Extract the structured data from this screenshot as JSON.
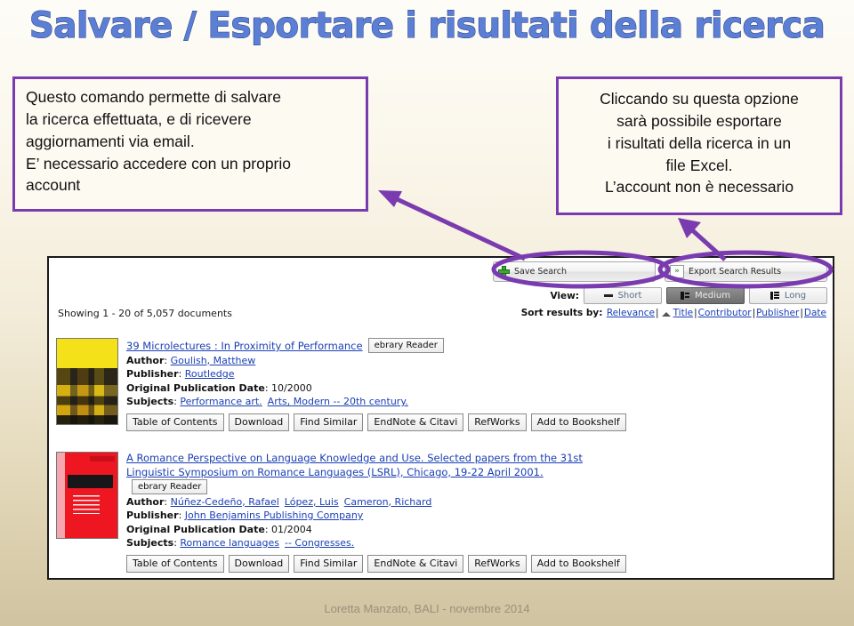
{
  "slide": {
    "title": "Salvare / Esportare i risultati della ricerca",
    "title_color": "#5b7fd4",
    "title_outline_color": "#2b3f8c",
    "accent_color": "#7b3bb0",
    "footer": "Loretta Manzato, BALI - novembre 2014"
  },
  "callout_left": {
    "line1": "Questo comando permette di salvare",
    "line2": "la ricerca effettuata, e di ricevere",
    "line3": "aggiornamenti via email.",
    "line4": "E’ necessario accedere con un proprio",
    "line5": "account"
  },
  "callout_right": {
    "line1": "Cliccando  su questa opzione",
    "line2": "sarà possibile esportare",
    "line3": "i risultati della ricerca in un",
    "line4": "file Excel.",
    "line5": "L’account non è necessario"
  },
  "screenshot": {
    "toolbar": {
      "save_search_label": "Save Search",
      "save_search_icon": "green-plus-icon",
      "export_results_label": "Export Search Results",
      "export_results_icon": "export-chevrons-icon",
      "view_label": "View:",
      "view_options": [
        {
          "label": "Short",
          "icon": "view-short-icon",
          "active": false
        },
        {
          "label": "Medium",
          "icon": "view-medium-icon",
          "active": true
        },
        {
          "label": "Long",
          "icon": "view-long-icon",
          "active": false
        }
      ],
      "sort_label": "Sort results by:",
      "sort_options": [
        "Relevance",
        "Title",
        "Contributor",
        "Publisher",
        "Date"
      ],
      "sort_active": "Title",
      "sort_caret_icon": "sort-ascending-caret-icon",
      "separator": "|"
    },
    "showing": "Showing 1 - 20 of 5,057 documents",
    "results": [
      {
        "title": "39 Microlectures : In Proximity of Performance",
        "reader_badge": "ebrary Reader",
        "author_label": "Author",
        "authors": [
          "Goulish, Matthew"
        ],
        "publisher_label": "Publisher",
        "publishers": [
          "Routledge"
        ],
        "date_label": "Original Publication Date",
        "date": "10/2000",
        "subjects_label": "Subjects",
        "subjects": [
          "Performance art.",
          "Arts, Modern -- 20th century."
        ],
        "cover": "yellow-mosaic-book-cover",
        "actions": [
          "Table of Contents",
          "Download",
          "Find Similar",
          "EndNote & Citavi",
          "RefWorks",
          "Add to Bookshelf"
        ]
      },
      {
        "title": "A Romance Perspective on Language Knowledge and Use. Selected papers from the 31st Linguistic Symposium on Romance Languages (LSRL), Chicago, 19-22 April 2001.",
        "reader_badge": "ebrary Reader",
        "author_label": "Author",
        "authors": [
          "Núñez-Cedeño, Rafael",
          "López, Luis",
          "Cameron, Richard"
        ],
        "publisher_label": "Publisher",
        "publishers": [
          "John Benjamins Publishing Company"
        ],
        "date_label": "Original Publication Date",
        "date": "01/2004",
        "subjects_label": "Subjects",
        "subjects": [
          "Romance languages",
          "-- Congresses."
        ],
        "cover": "red-book-cover",
        "actions": [
          "Table of Contents",
          "Download",
          "Find Similar",
          "EndNote & Citavi",
          "RefWorks",
          "Add to Bookshelf"
        ]
      }
    ]
  },
  "annotations": {
    "ellipse_save_search": "purple-ellipse-highlight",
    "ellipse_export_results": "purple-ellipse-highlight",
    "arrow_to_left_callout": "purple-arrow",
    "arrow_to_right_callout": "purple-arrow"
  }
}
